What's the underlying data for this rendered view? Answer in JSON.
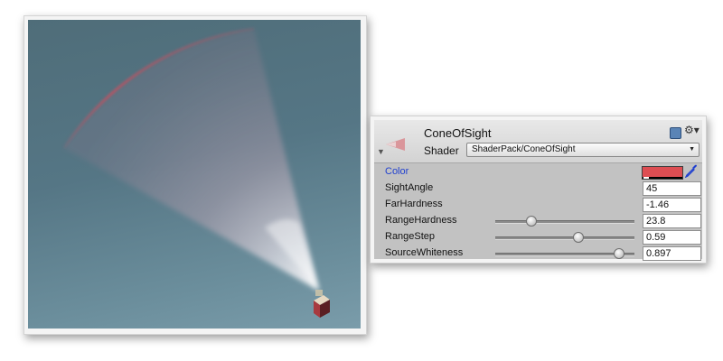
{
  "inspector": {
    "material_name": "ConeOfSight",
    "shader_label": "Shader",
    "shader_value": "ShaderPack/ConeOfSight",
    "properties": [
      {
        "label": "Color",
        "type": "color",
        "value": "#dd4d52"
      },
      {
        "label": "SightAngle",
        "type": "float",
        "value": "45"
      },
      {
        "label": "FarHardness",
        "type": "float",
        "value": "-1.46"
      },
      {
        "label": "RangeHardness",
        "type": "range",
        "value": "23.8",
        "slider_fraction": 0.25
      },
      {
        "label": "RangeStep",
        "type": "range",
        "value": "0.59",
        "slider_fraction": 0.59
      },
      {
        "label": "SourceWhiteness",
        "type": "range",
        "value": "0.897",
        "slider_fraction": 0.88
      }
    ]
  },
  "icons": {
    "help": "help-book-icon",
    "settings": "gear-icon",
    "foldout": "foldout-arrow-icon",
    "dropdown": "chevron-down-icon",
    "eyedropper": "eyedropper-icon"
  },
  "colors": {
    "scene_background": "#557685",
    "cone_rim": "#d64a5a",
    "property_highlight": "#1f3fcf"
  }
}
